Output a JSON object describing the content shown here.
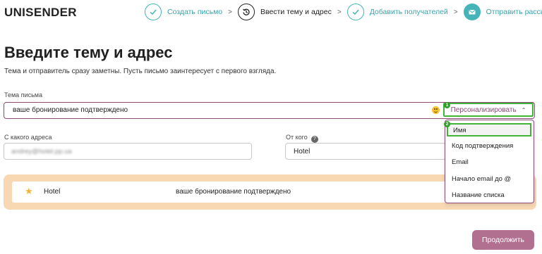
{
  "header": {
    "logo": "UNISENDER",
    "steps": [
      {
        "label": "Создать письмо",
        "state": "done",
        "icon": "check-icon"
      },
      {
        "label": "Ввести тему и адрес",
        "state": "current",
        "icon": "history-icon"
      },
      {
        "label": "Добавить получателей",
        "state": "done",
        "icon": "check-icon"
      },
      {
        "label": "Отправить рассылку",
        "state": "pending",
        "icon": "envelope-icon"
      }
    ],
    "separator": ">"
  },
  "page": {
    "title": "Введите тему и адрес",
    "subtitle": "Тема и отправитель сразу заметны. Пусть письмо заинтересует с первого взгляда."
  },
  "subject": {
    "label": "Тема письма",
    "value": "ваше бронирование подтверждено",
    "personalize_label": "Персонализировать",
    "badge": "1"
  },
  "from_address": {
    "label": "С какого адреса",
    "value": "andrey@hotel.pp.ua"
  },
  "from_name": {
    "label": "От кого",
    "help": "?",
    "value": "Hotel"
  },
  "preview": {
    "sender": "Hotel",
    "subject": "ваше бронирование подтверждено"
  },
  "dropdown": {
    "badge": "2",
    "items": [
      "Имя",
      "Код подтверждения",
      "Email",
      "Начало email до @",
      "Название списка"
    ],
    "selected_index": 0
  },
  "continue_label": "Продолжить",
  "colors": {
    "accent_teal": "#45b4b8",
    "brand_plum": "#8e4a77",
    "button": "#b1708f",
    "highlight_green": "#43b43a",
    "preview_bg": "#f7d8b3"
  }
}
